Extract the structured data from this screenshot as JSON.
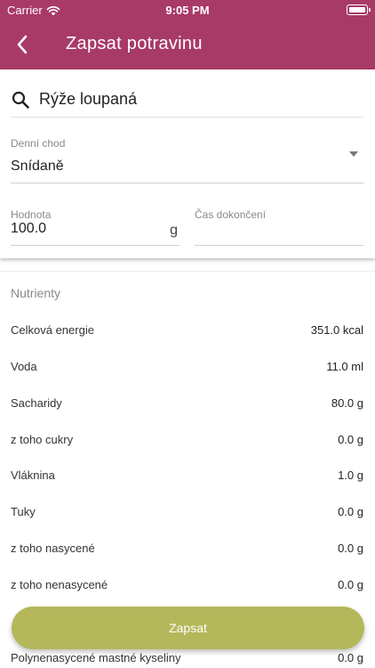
{
  "status_bar": {
    "carrier": "Carrier",
    "time": "9:05 PM",
    "wifi_icon": "wifi-icon",
    "battery_icon": "battery-icon"
  },
  "nav": {
    "title": "Zapsat potravinu",
    "back_icon": "chevron-left-icon"
  },
  "search": {
    "value": "Rýže loupaná",
    "icon": "search-icon"
  },
  "meal": {
    "label": "Denní chod",
    "value": "Snídaně"
  },
  "amount": {
    "label": "Hodnota",
    "value": "100.0",
    "unit": "g"
  },
  "completion": {
    "label": "Čas dokončení",
    "value": ""
  },
  "nutrients": {
    "heading": "Nutrienty",
    "rows": [
      {
        "name": "Celková energie",
        "value": "351.0 kcal"
      },
      {
        "name": "Voda",
        "value": "11.0 ml"
      },
      {
        "name": "Sacharidy",
        "value": "80.0 g"
      },
      {
        "name": "z toho cukry",
        "value": "0.0 g"
      },
      {
        "name": "Vláknina",
        "value": "1.0 g"
      },
      {
        "name": "Tuky",
        "value": "0.0 g"
      },
      {
        "name": "z toho nasycené",
        "value": "0.0 g"
      },
      {
        "name": "z toho nenasycené",
        "value": "0.0 g"
      },
      {
        "name": "Polynenasycené mastné kyseliny",
        "value": "0.0 g"
      }
    ]
  },
  "submit": {
    "label": "Zapsat"
  },
  "colors": {
    "header": "#a83a68",
    "submit": "#b4b85a"
  }
}
